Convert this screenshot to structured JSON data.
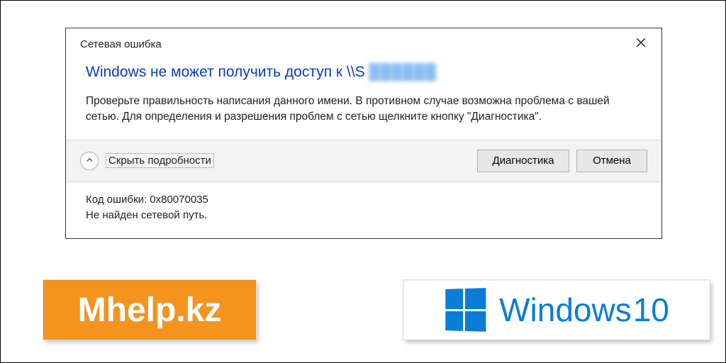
{
  "dialog": {
    "title": "Сетевая ошибка",
    "heading_prefix": "Windows не может получить доступ к \\\\S",
    "heading_blurred": "██████",
    "description": "Проверьте правильность написания данного имени. В противном случае возможна проблема с вашей сетью. Для определения и разрешения проблем с сетью щелкните кнопку \"Диагностика\".",
    "toggle_label": "Скрыть подробности",
    "diagnose_label": "Диагностика",
    "cancel_label": "Отмена",
    "details_line1": "Код ошибки: 0x80070035",
    "details_line2": "Не найден сетевой путь."
  },
  "badges": {
    "mhelp": "Mhelp.kz",
    "win_prefix": "Windows",
    "win_suffix": "10"
  }
}
